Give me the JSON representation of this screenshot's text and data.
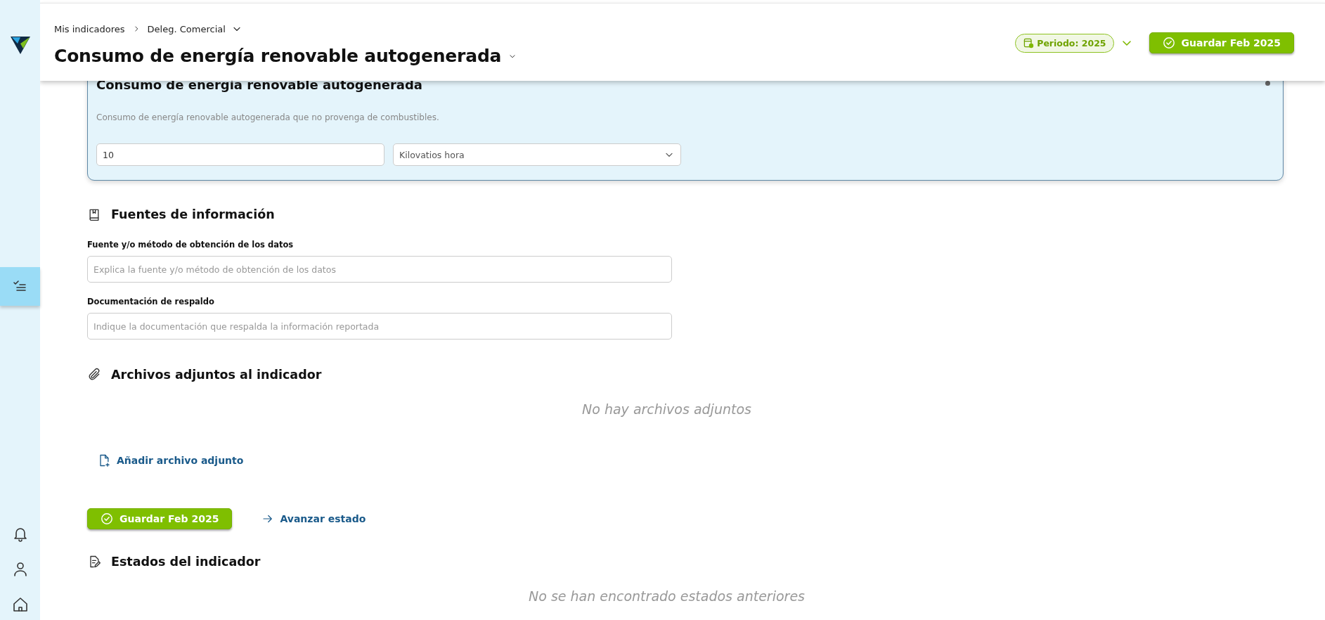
{
  "sidebar": {
    "top_items": [
      {
        "kind": "indicators",
        "selected": true
      }
    ],
    "bottom_items": [
      {
        "kind": "notifications",
        "selected": false
      },
      {
        "kind": "profile",
        "selected": false
      },
      {
        "kind": "home",
        "selected": false
      }
    ]
  },
  "header": {
    "breadcrumb": [
      {
        "label": "Mis indicadores",
        "dropdown": false
      },
      {
        "label": "Deleg. Comercial",
        "dropdown": true
      }
    ],
    "title": "Consumo de energía renovable autogenerada",
    "period_button": "Periodo: 2025",
    "save_button": "Guardar Feb 2025"
  },
  "indicator_card": {
    "title": "Consumo de energía renovable autogenerada",
    "description": "Consumo de energía renovable autogenerada que no provenga de combustibles.",
    "value": "10",
    "unit": "Kilovatios hora"
  },
  "sources": {
    "heading": "Fuentes de información",
    "fields": [
      {
        "label": "Fuente y/o método de obtención de los datos",
        "placeholder": "Explica la fuente y/o método de obtención de los datos"
      },
      {
        "label": "Documentación de respaldo",
        "placeholder": "Indique la documentación que respalda la información reportada"
      }
    ]
  },
  "attachments": {
    "heading": "Archivos adjuntos al indicador",
    "empty_message": "No hay archivos adjuntos",
    "add_link": "Añadir archivo adjunto"
  },
  "actions": {
    "save_button": "Guardar Feb 2025",
    "advance_link": "Avanzar estado"
  },
  "states": {
    "heading": "Estados del indicador",
    "empty_message": "No se han encontrado estados anteriores"
  }
}
